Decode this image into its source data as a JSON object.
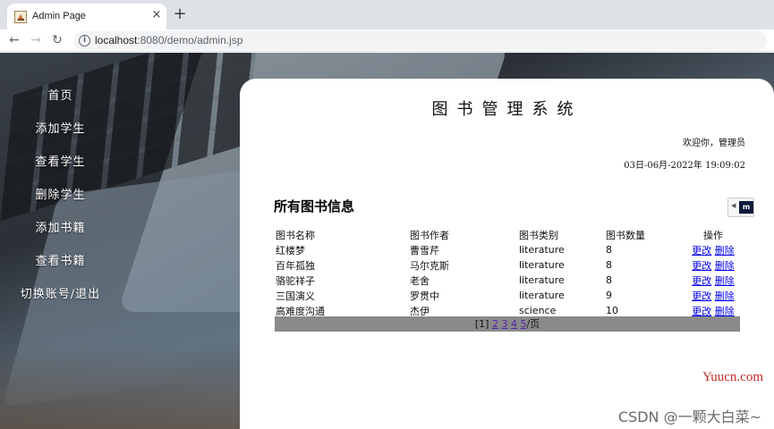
{
  "browser": {
    "tab_title": "Admin Page",
    "tab_close": "×",
    "new_tab": "+",
    "url_host": "localhost",
    "url_rest": ":8080/demo/admin.jsp",
    "back": "←",
    "forward": "→",
    "reload": "↻",
    "info": "i"
  },
  "sidebar": {
    "items": [
      {
        "label": "首页"
      },
      {
        "label": "添加学生"
      },
      {
        "label": "查看学生"
      },
      {
        "label": "删除学生"
      },
      {
        "label": "添加书籍"
      },
      {
        "label": "查看书籍"
      },
      {
        "label": "切换账号/退出"
      }
    ]
  },
  "panel": {
    "title": "图书管理系统",
    "welcome": "欢迎你，管理员",
    "datetime": "03日-06月-2022年 19:09:02",
    "section_title": "所有图书信息",
    "widget_arrow": "◀",
    "widget_logo": "m"
  },
  "table": {
    "headers": [
      "图书名称",
      "图书作者",
      "图书类别",
      "图书数量",
      "操作"
    ],
    "rows": [
      {
        "name": "红楼梦",
        "author": "曹雪芹",
        "category": "literature",
        "count": "8",
        "edit": "更改",
        "delete": "删除"
      },
      {
        "name": "百年孤独",
        "author": "马尔克斯",
        "category": "literature",
        "count": "8",
        "edit": "更改",
        "delete": "删除"
      },
      {
        "name": "骆驼祥子",
        "author": "老舍",
        "category": "literature",
        "count": "8",
        "edit": "更改",
        "delete": "删除"
      },
      {
        "name": "三国演义",
        "author": "罗贯中",
        "category": "literature",
        "count": "9",
        "edit": "更改",
        "delete": "删除"
      },
      {
        "name": "高难度沟通",
        "author": "杰伊",
        "category": "science",
        "count": "10",
        "edit": "更改",
        "delete": "删除"
      }
    ]
  },
  "pager": {
    "current": "[1]",
    "pages": [
      "2",
      "3",
      "4",
      "5"
    ],
    "suffix": "/页"
  },
  "watermarks": {
    "site": "Yuucn.com",
    "csdn": "CSDN @一颗大白菜~"
  }
}
